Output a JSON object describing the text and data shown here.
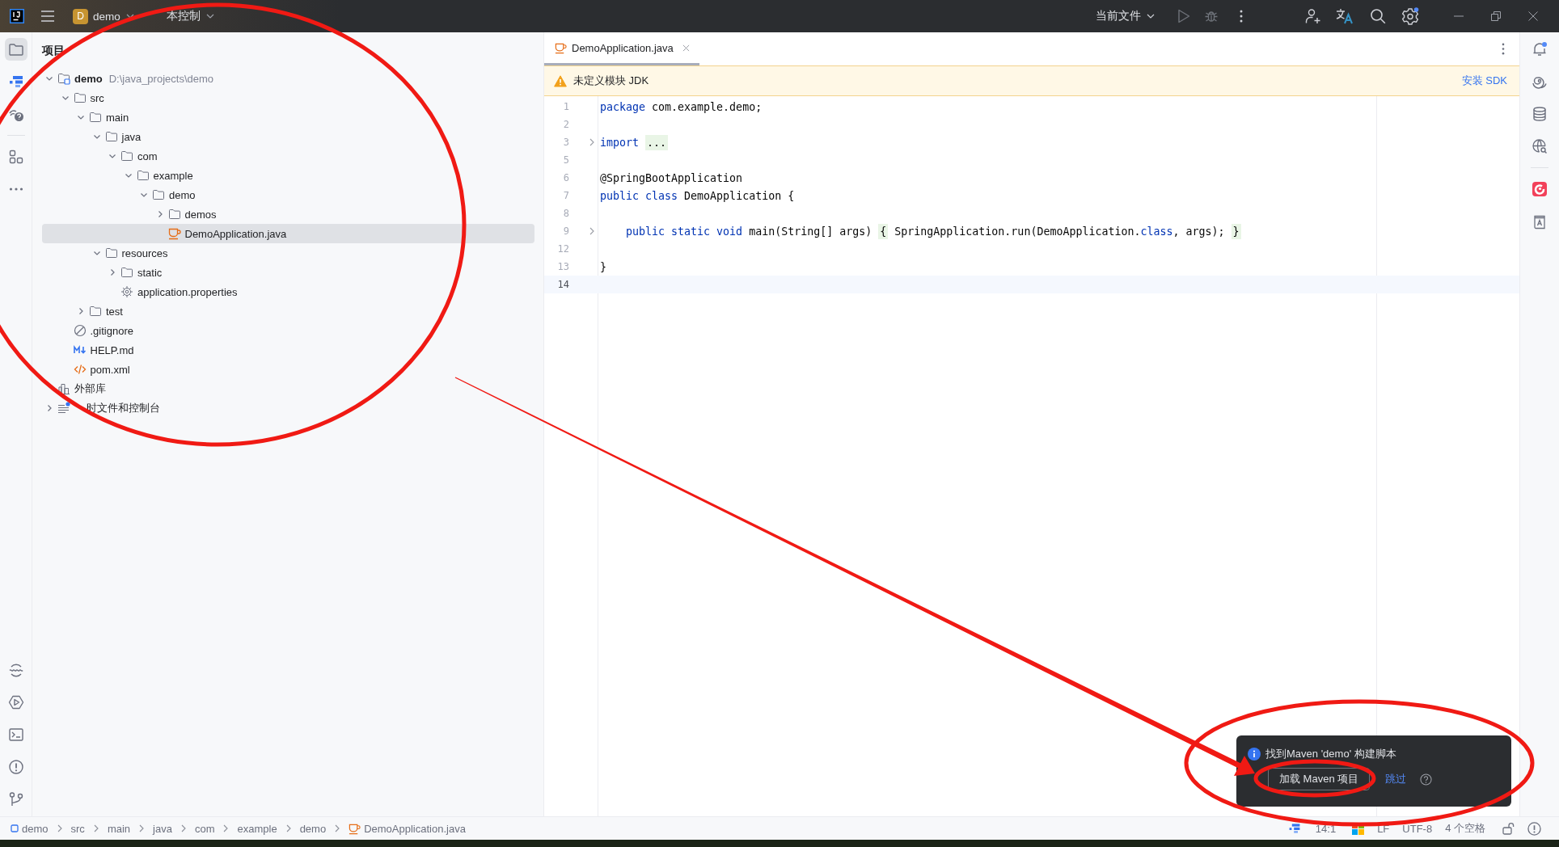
{
  "title_bar": {
    "project_initial": "D",
    "project": "demo",
    "vcs": "本控制",
    "run_config": "当前文件"
  },
  "project_panel": {
    "title": "项目",
    "tree": [
      {
        "name": "demo",
        "path": "D:\\java_projects\\demo",
        "kind": "module",
        "expanded": true,
        "selected": false,
        "children": [
          {
            "name": "src",
            "kind": "folder",
            "expanded": true,
            "selected": false,
            "children": [
              {
                "name": "main",
                "kind": "folder",
                "expanded": true,
                "selected": false,
                "children": [
                  {
                    "name": "java",
                    "kind": "folder",
                    "expanded": true,
                    "selected": false,
                    "children": [
                      {
                        "name": "com",
                        "kind": "folder",
                        "expanded": true,
                        "selected": false,
                        "children": [
                          {
                            "name": "example",
                            "kind": "folder",
                            "expanded": true,
                            "selected": false,
                            "children": [
                              {
                                "name": "demo",
                                "kind": "folder",
                                "expanded": true,
                                "selected": false,
                                "children": [
                                  {
                                    "name": "demos",
                                    "kind": "folder",
                                    "expanded": false,
                                    "selected": false
                                  },
                                  {
                                    "name": "DemoApplication.java",
                                    "kind": "java",
                                    "selected": true
                                  }
                                ]
                              }
                            ]
                          }
                        ]
                      }
                    ]
                  },
                  {
                    "name": "resources",
                    "kind": "folder",
                    "expanded": true,
                    "selected": false,
                    "children": [
                      {
                        "name": "static",
                        "kind": "folder",
                        "expanded": false,
                        "selected": false
                      },
                      {
                        "name": "application.properties",
                        "kind": "properties",
                        "selected": false
                      }
                    ]
                  }
                ]
              },
              {
                "name": "test",
                "kind": "folder",
                "expanded": false,
                "selected": false
              }
            ]
          },
          {
            "name": ".gitignore",
            "kind": "gitignore",
            "selected": false
          },
          {
            "name": "HELP.md",
            "kind": "markdown",
            "selected": false
          },
          {
            "name": "pom.xml",
            "kind": "xml",
            "selected": false
          }
        ]
      },
      {
        "name": "外部库",
        "kind": "library",
        "selected": false
      },
      {
        "name": "时文件和控制台",
        "kind": "scratch",
        "expanded": false,
        "selected": false
      }
    ]
  },
  "editor": {
    "tabs": [
      {
        "label": "DemoApplication.java",
        "selected": true
      }
    ],
    "banner": {
      "message": "未定义模块 JDK",
      "action": "安装 SDK"
    },
    "lines": [
      {
        "number": "1",
        "foldable": false,
        "current": false,
        "tokens": [
          {
            "text": "package",
            "kind": "keyword"
          },
          {
            "text": " com.example.demo;",
            "kind": "plain"
          }
        ]
      },
      {
        "number": "2",
        "foldable": false,
        "current": false
      },
      {
        "number": "3",
        "foldable": true,
        "current": false,
        "tokens": [
          {
            "text": "import ",
            "kind": "keyword"
          },
          {
            "text": "...",
            "kind": "folded"
          }
        ]
      },
      {
        "number": "5",
        "foldable": false,
        "current": false
      },
      {
        "number": "6",
        "foldable": false,
        "current": false,
        "tokens": [
          {
            "text": "@SpringBootApplication",
            "kind": "plain"
          }
        ]
      },
      {
        "number": "7",
        "foldable": false,
        "current": false,
        "tokens": [
          {
            "text": "public class",
            "kind": "keyword"
          },
          {
            "text": " DemoApplication {",
            "kind": "plain"
          }
        ]
      },
      {
        "number": "8",
        "foldable": false,
        "current": false
      },
      {
        "number": "9",
        "foldable": true,
        "current": false,
        "tokens": [
          {
            "text": "    public static void",
            "kind": "keyword"
          },
          {
            "text": " main(String[] args) ",
            "kind": "plain"
          },
          {
            "text": "{",
            "kind": "folded"
          },
          {
            "text": " SpringApplication.run(DemoApplication.",
            "kind": "plain"
          },
          {
            "text": "class",
            "kind": "keyword"
          },
          {
            "text": ", args); ",
            "kind": "plain"
          },
          {
            "text": "}",
            "kind": "folded"
          }
        ]
      },
      {
        "number": "12",
        "foldable": false,
        "current": false
      },
      {
        "number": "13",
        "foldable": false,
        "current": false,
        "tokens": [
          {
            "text": "}",
            "kind": "plain"
          }
        ]
      },
      {
        "number": "14",
        "foldable": false,
        "current": true
      }
    ]
  },
  "notification": {
    "message": "找到Maven 'demo' 构建脚本",
    "button": "加载 Maven 项目",
    "link": "跳过"
  },
  "status_bar": {
    "breadcrumbs": [
      {
        "label": "demo",
        "kind": "module"
      },
      {
        "label": "src",
        "kind": "folder"
      },
      {
        "label": "main",
        "kind": "folder"
      },
      {
        "label": "java",
        "kind": "folder"
      },
      {
        "label": "com",
        "kind": "folder"
      },
      {
        "label": "example",
        "kind": "folder"
      },
      {
        "label": "demo",
        "kind": "folder"
      },
      {
        "label": "DemoApplication.java",
        "kind": "java"
      }
    ],
    "position": "14:1",
    "line_separator": "LF",
    "encoding": "UTF-8",
    "indent": "4 个空格"
  }
}
